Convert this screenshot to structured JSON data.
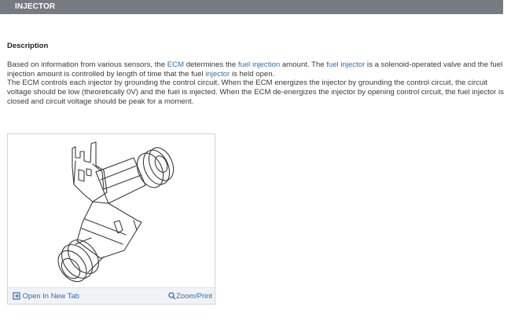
{
  "header": {
    "title": "INJECTOR"
  },
  "description": {
    "heading": "Description",
    "p1": [
      {
        "text": "Based on information from various sensors, the ",
        "link": false
      },
      {
        "text": "ECM",
        "link": true
      },
      {
        "text": " determines the ",
        "link": false
      },
      {
        "text": "fuel injection",
        "link": true
      },
      {
        "text": " amount. The ",
        "link": false
      },
      {
        "text": "fuel injector",
        "link": true
      },
      {
        "text": " is a solenoid-operated valve and the fuel injection amount is controlled by length of time that the fuel ",
        "link": false
      },
      {
        "text": "injector",
        "link": true
      },
      {
        "text": " is held open.",
        "link": false
      }
    ],
    "p2": "The ECM controls each injector by grounding the control circuit. When the ECM energizes the injector by grounding the control circuit, the circuit voltage should be low (theoretically 0V) and the fuel is injected. When the ECM de-energizes the injector by opening control circuit, the fuel injector is closed and circuit voltage should be peak for a moment."
  },
  "figure": {
    "open_new_tab_label": "Open In New Tab",
    "zoom_print_label": "Zoom/Print"
  },
  "colors": {
    "header_bg": "#767b82",
    "link": "#2e6fb0",
    "text": "#3a3a3a"
  }
}
